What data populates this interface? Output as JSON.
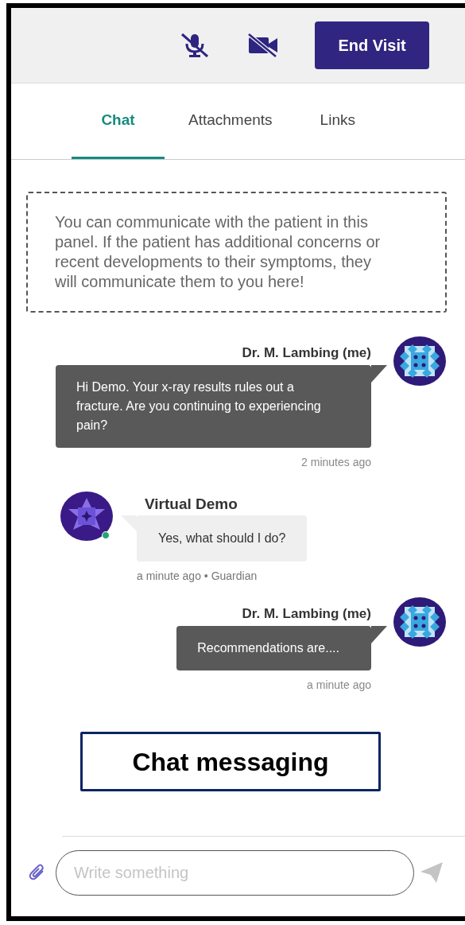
{
  "header": {
    "mic_muted": true,
    "camera_off": true,
    "end_button": "End Visit"
  },
  "tabs": [
    {
      "label": "Chat",
      "selected": true
    },
    {
      "label": "Attachments",
      "selected": false
    },
    {
      "label": "Links",
      "selected": false
    }
  ],
  "notice": "You can communicate with the patient in this panel. If the patient has additional concerns or recent developments to their symptoms, they will communicate them to you here!",
  "messages": [
    {
      "kind": "outgoing",
      "sender": "Dr. M. Lambing (me)",
      "text": "Hi Demo. Your x-ray  results rules out a fracture. Are you continuing to experiencing pain?",
      "time": "2 minutes ago"
    },
    {
      "kind": "incoming",
      "sender": "Virtual Demo",
      "online": true,
      "text": "Yes, what should I do?",
      "time": "a minute ago • Guardian"
    },
    {
      "kind": "outgoing",
      "sender": "Dr. M. Lambing (me)",
      "text": "Recommendations are....",
      "time": "a minute ago"
    }
  ],
  "caption": "Chat messaging",
  "composer": {
    "placeholder": "Write something"
  }
}
